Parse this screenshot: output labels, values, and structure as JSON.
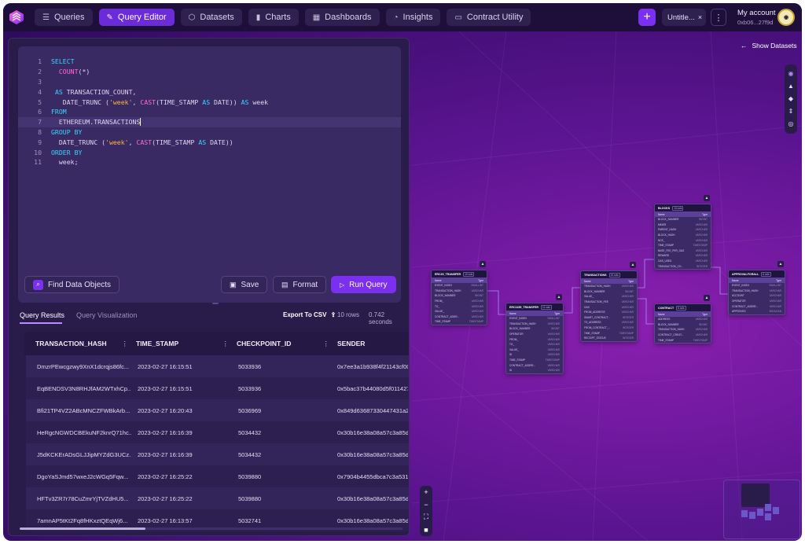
{
  "nav": {
    "items": [
      {
        "label": "Queries",
        "icon": "list-icon"
      },
      {
        "label": "Query Editor",
        "icon": "edit-icon",
        "active": true
      },
      {
        "label": "Datasets",
        "icon": "cube-icon"
      },
      {
        "label": "Charts",
        "icon": "bar-chart-icon"
      },
      {
        "label": "Dashboards",
        "icon": "grid-icon"
      },
      {
        "label": "Insights",
        "icon": "gauge-icon"
      },
      {
        "label": "Contract Utility",
        "icon": "terminal-icon"
      }
    ],
    "tab_label": "Untitle...",
    "account_label": "My account",
    "account_address": "0xb06...27f9d"
  },
  "colors": {
    "accent": "#7b2ff0",
    "topbar": "#1d0f3a",
    "panel": "#2a1c4a",
    "editor": "#3a2a63",
    "keyword": "#36d6ff",
    "function": "#ff6ad5",
    "string": "#ffb340"
  },
  "editor": {
    "lines": [
      [
        {
          "t": "SELECT",
          "c": "kw"
        }
      ],
      [
        {
          "t": "  "
        },
        {
          "t": "COUNT",
          "c": "fn"
        },
        {
          "t": "(*)"
        }
      ],
      [],
      [
        {
          "t": " "
        },
        {
          "t": "AS",
          "c": "as"
        },
        {
          "t": " TRANSACTION_COUNT,"
        }
      ],
      [
        {
          "t": "   DATE_TRUNC ("
        },
        {
          "t": "'week'",
          "c": "str"
        },
        {
          "t": ", "
        },
        {
          "t": "CAST",
          "c": "fn"
        },
        {
          "t": "(TIME_STAMP "
        },
        {
          "t": "AS",
          "c": "as"
        },
        {
          "t": " DATE)) "
        },
        {
          "t": "AS",
          "c": "as"
        },
        {
          "t": " week"
        }
      ],
      [
        {
          "t": "FROM",
          "c": "kw"
        }
      ],
      [
        {
          "t": "  ETHEREUM.TRANSACTIONS"
        }
      ],
      [
        {
          "t": "GROUP BY",
          "c": "kw"
        }
      ],
      [
        {
          "t": "  DATE_TRUNC ("
        },
        {
          "t": "'week'",
          "c": "str"
        },
        {
          "t": ", "
        },
        {
          "t": "CAST",
          "c": "fn"
        },
        {
          "t": "(TIME_STAMP "
        },
        {
          "t": "AS",
          "c": "as"
        },
        {
          "t": " DATE))"
        }
      ],
      [
        {
          "t": "ORDER BY",
          "c": "kw"
        }
      ],
      [
        {
          "t": "  week;"
        }
      ]
    ],
    "highlighted_line": 7,
    "find_label": "Find Data Objects",
    "save_label": "Save",
    "format_label": "Format",
    "run_label": "Run Query"
  },
  "results": {
    "tab_results": "Query Results",
    "tab_viz": "Query Visualization",
    "export_label": "Export To CSV",
    "rows_info": "10 rows",
    "time_info": "0.742 seconds",
    "columns": [
      "TRANSACTION_HASH",
      "TIME_STAMP",
      "CHECKPOINT_ID",
      "SENDER"
    ],
    "rows": [
      [
        "DmzrPEwcgzwy9XnX1dcrqjs86fc...",
        "2023-02-27 16:15:51",
        "5033936",
        "0x7ee3a1b938f4f21143cf00"
      ],
      [
        "EqBENDSV3N8RHJfAM2WTxhCp...",
        "2023-02-27 16:15:51",
        "5033936",
        "0x5bac37b44080d5f011427"
      ],
      [
        "Bfi21TP4VZ2ABcMNCZFWBkArb...",
        "2023-02-27 16:20:43",
        "5036969",
        "0x849d63687330447431a2"
      ],
      [
        "HeRgcNGWDCBEkuNF2knrQ71hc...",
        "2023-02-27 16:16:39",
        "5034432",
        "0x30b16e38a08a57c3a85d9"
      ],
      [
        "J5dKCKErADsGLJJipMYZdG3UCz...",
        "2023-02-27 16:16:39",
        "5034432",
        "0x30b16e38a08a57c3a85d9"
      ],
      [
        "DgoYaSJmd57wxeJ2cWGq5Fqw...",
        "2023-02-27 16:25:22",
        "5039880",
        "0x7904b4455dbca7c3a531a"
      ],
      [
        "HFTv3ZR7r78CuZmrYjTVZdHU5...",
        "2023-02-27 16:25:22",
        "5039880",
        "0x30b16e38a08a57c3a85d9"
      ],
      [
        "7amnAP5tKt2Fq8fHKxztQEqWj6...",
        "2023-02-27 16:13:57",
        "5032741",
        "0x30b16e38a08a57c3a85d9"
      ]
    ]
  },
  "canvas": {
    "show_datasets_label": "Show Datasets",
    "side_tools": [
      "cursor-icon",
      "layers-icon",
      "shapes-icon",
      "collapse-icon",
      "eye-icon"
    ],
    "zoom_tools": [
      "zoom-in-icon",
      "zoom-out-icon",
      "fit-icon",
      "lock-icon"
    ],
    "tables": [
      {
        "id": "erc20",
        "title": "ERC20_TRANSFER",
        "count": "10 cols",
        "rows": [
          [
            "EVENT_INDEX",
            "SMALLINT"
          ],
          [
            "TRANSACTION_HASH",
            "VARCHAR"
          ],
          [
            "BLOCK_NUMBER",
            "BIGINT"
          ],
          [
            "FROM_",
            "VARCHAR"
          ],
          [
            "TO_",
            "VARCHAR"
          ],
          [
            "VALUE_",
            "VARCHAR"
          ],
          [
            "CONTRACT_ADDR...",
            "VARCHAR"
          ],
          [
            "TIME_STAMP",
            "TIMESTAMP"
          ]
        ]
      },
      {
        "id": "erc1155",
        "title": "ERC1155_TRANSFER",
        "count": "11 cols",
        "rows": [
          [
            "EVENT_INDEX",
            "SMALLINT"
          ],
          [
            "TRANSACTION_HASH",
            "VARCHAR"
          ],
          [
            "BLOCK_NUMBER",
            "BIGINT"
          ],
          [
            "OPERATOR",
            "VARCHAR"
          ],
          [
            "FROM_",
            "VARCHAR"
          ],
          [
            "TO_",
            "VARCHAR"
          ],
          [
            "VALUE_",
            "VARCHAR"
          ],
          [
            "ID",
            "VARCHAR"
          ],
          [
            "TIME_STAMP",
            "TIMESTAMP"
          ],
          [
            "CONTRACT_ADDRE...",
            "VARCHAR"
          ],
          [
            "ID",
            "VARCHAR"
          ]
        ]
      },
      {
        "id": "transactions",
        "title": "TRANSACTIONS",
        "count": "14 cols",
        "rows": [
          [
            "TRANSACTION_HASH",
            "VARCHAR"
          ],
          [
            "BLOCK_NUMBER",
            "BIGINT"
          ],
          [
            "VALUE_",
            "VARCHAR"
          ],
          [
            "TRANSACTION_FEE",
            "VARCHAR"
          ],
          [
            "GAS",
            "VARCHAR"
          ],
          [
            "FROM_ADDRESS",
            "VARCHAR"
          ],
          [
            "SMART_CONTRACT...",
            "INTEGER"
          ],
          [
            "TO_ADDRESS",
            "VARCHAR"
          ],
          [
            "FROM_CONTRACT_...",
            "INTEGER"
          ],
          [
            "TIME_STAMP",
            "TIMESTAMP"
          ],
          [
            "RECEIPT_STATUS",
            "INTEGER"
          ]
        ]
      },
      {
        "id": "blocks",
        "title": "BLOCKS",
        "count": "14 cols",
        "rows": [
          [
            "BLOCK_NUMBER",
            "BIGINT"
          ],
          [
            "MINER",
            "VARCHAR"
          ],
          [
            "PARENT_HASH",
            "VARCHAR"
          ],
          [
            "BLOCK_HASH",
            "VARCHAR"
          ],
          [
            "NCE_",
            "VARCHAR"
          ],
          [
            "TIME_STAMP",
            "TIMESTAMP"
          ],
          [
            "BASE_FEE_PER_GAS",
            "VARCHAR"
          ],
          [
            "REWARD",
            "VARCHAR"
          ],
          [
            "GAS_USED",
            "VARCHAR"
          ],
          [
            "TRANSACTION_CO...",
            "INTEGER"
          ]
        ]
      },
      {
        "id": "contract",
        "title": "CONTRACT",
        "count": "6 cols",
        "rows": [
          [
            "ADDRESS",
            "VARCHAR"
          ],
          [
            "BLOCK_NUMBER",
            "BIGINT"
          ],
          [
            "TRANSACTION_HASH",
            "VARCHAR"
          ],
          [
            "CONTRACT_CREAT...",
            "VARCHAR"
          ],
          [
            "TIME_STAMP",
            "TIMESTAMP"
          ]
        ]
      },
      {
        "id": "approval",
        "title": "APPROVALFORALL",
        "count": "6 cols",
        "rows": [
          [
            "EVENT_INDEX",
            "SMALLINT"
          ],
          [
            "TRANSACTION_HASH",
            "VARCHAR"
          ],
          [
            "ACCOUNT",
            "VARCHAR"
          ],
          [
            "OPERATOR",
            "VARCHAR"
          ],
          [
            "CONTRACT_ADDRE...",
            "VARCHAR"
          ],
          [
            "APPROVED",
            "BOOLEAN"
          ]
        ]
      }
    ],
    "table_header_name": "Name",
    "table_header_type": "Type"
  }
}
